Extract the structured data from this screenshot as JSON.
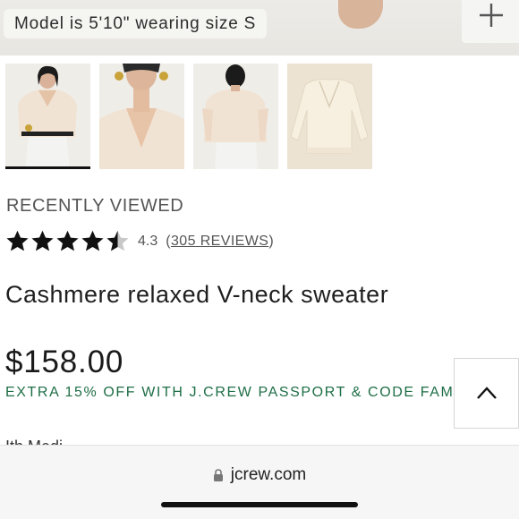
{
  "hero": {
    "model_note": "Model is 5'10\" wearing size S",
    "expand_icon": "plus-icon"
  },
  "gallery": {
    "thumbnails": [
      {
        "alt": "model-front",
        "selected": true
      },
      {
        "alt": "neckline-closeup",
        "selected": false
      },
      {
        "alt": "model-back",
        "selected": false
      },
      {
        "alt": "flat-lay",
        "selected": false
      }
    ],
    "colors": {
      "sweater": "#f1e3d3",
      "background": "#efede8",
      "flatlay_bg": "#ece3d3"
    }
  },
  "section": {
    "recently_viewed": "RECENTLY VIEWED"
  },
  "product": {
    "rating": 4.3,
    "rating_text": "4.3",
    "reviews_open": "(",
    "reviews_text": "305 REVIEWS",
    "reviews_close": ")",
    "name": "Cashmere relaxed V-neck sweater",
    "price": "$158.00",
    "promo": "EXTRA 15% OFF WITH J.CREW PASSPORT & CODE FAM",
    "cutoff_text": "Ith Medi..."
  },
  "scroll_top": {
    "icon": "chevron-up-icon"
  },
  "browser": {
    "url": "jcrew.com",
    "lock_icon": "lock-icon"
  },
  "colors": {
    "promo_green": "#1e6e46",
    "star": "#111111",
    "star_empty": "#c8c8c8"
  }
}
